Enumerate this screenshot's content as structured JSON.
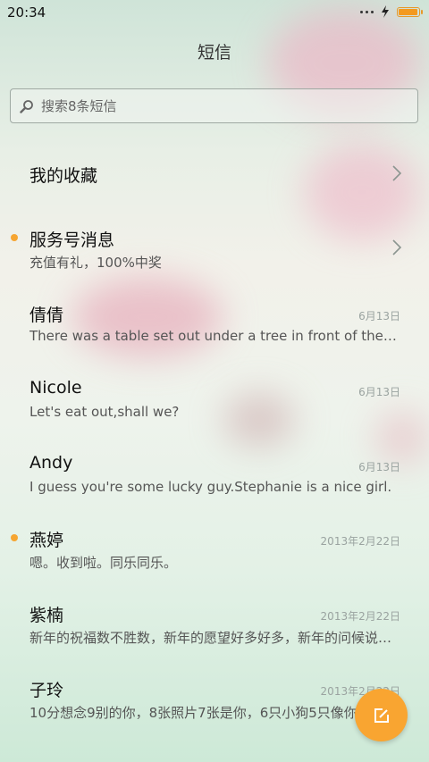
{
  "status": {
    "time": "20:34",
    "battery_level": 0.95,
    "accent": "#f39a1f"
  },
  "header": {
    "title": "短信"
  },
  "search": {
    "placeholder": "搜索8条短信",
    "icon": "search-icon"
  },
  "sections": [
    {
      "name": "我的收藏",
      "icon": "chevron-right-icon"
    },
    {
      "name": "服务号消息",
      "snippet": "充值有礼，100%中奖",
      "unread": true,
      "icon": "chevron-right-icon"
    }
  ],
  "conversations": [
    {
      "name": "倩倩",
      "snippet": "There was a table set out under a tree in front of the house",
      "date": "6月13日",
      "unread": false
    },
    {
      "name": "Nicole",
      "snippet": "Let's eat out,shall we?",
      "date": "6月13日",
      "unread": false
    },
    {
      "name": "Andy",
      "snippet": "I guess you're some lucky guy.Stephanie is a nice girl.",
      "date": "6月13日",
      "unread": false
    },
    {
      "name": "燕婷",
      "snippet": "嗯。收到啦。同乐同乐。",
      "date": "2013年2月22日",
      "unread": true
    },
    {
      "name": "紫楠",
      "snippet": "新年的祝福数不胜数，新年的愿望好多好多，新年的问候说不完",
      "date": "2013年2月22日",
      "unread": false
    },
    {
      "name": "子玲",
      "snippet": "10分想念9别的你，8张照片7张是你，6只小狗5只像你",
      "date": "2013年2月22日",
      "unread": false
    }
  ],
  "fab": {
    "icon": "compose-icon",
    "color": "#f9a531"
  },
  "colors": {
    "unread_dot": "#f6a531"
  }
}
